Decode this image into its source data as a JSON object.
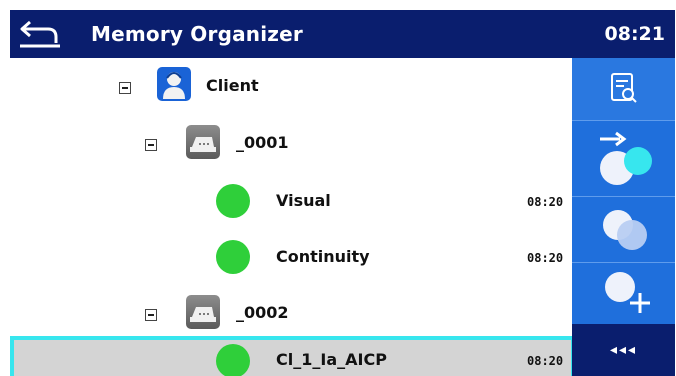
{
  "header": {
    "title": "Memory Organizer",
    "time": "08:21",
    "back_icon": "back-arrow-icon"
  },
  "tree": {
    "nodes": [
      {
        "type": "client",
        "label": "Client",
        "icon": "client-icon",
        "expanded": true
      },
      {
        "type": "appliance",
        "label": "_0001",
        "icon": "appliance-icon",
        "expanded": true
      },
      {
        "type": "measurement",
        "label": "Visual",
        "time": "08:20",
        "status": "pass"
      },
      {
        "type": "measurement",
        "label": "Continuity",
        "time": "08:20",
        "status": "pass"
      },
      {
        "type": "appliance",
        "label": "_0002",
        "icon": "appliance-icon",
        "expanded": true
      },
      {
        "type": "measurement",
        "label": "Cl_1_Ia_AICP",
        "time": "08:20",
        "status": "pass",
        "selected": true
      }
    ]
  },
  "sidebar": {
    "buttons": [
      {
        "icon": "view-details-icon"
      },
      {
        "icon": "start-test-icon"
      },
      {
        "icon": "clone-icon"
      },
      {
        "icon": "add-measurement-icon"
      }
    ],
    "more_label": "◂◂◂"
  },
  "colors": {
    "header_bg": "#0a1e6e",
    "sidebar_bg": "#1f6fdc",
    "pass_green": "#2fcf3a",
    "selection_border": "#37e6ee",
    "selection_bg": "#d4d4d4"
  }
}
